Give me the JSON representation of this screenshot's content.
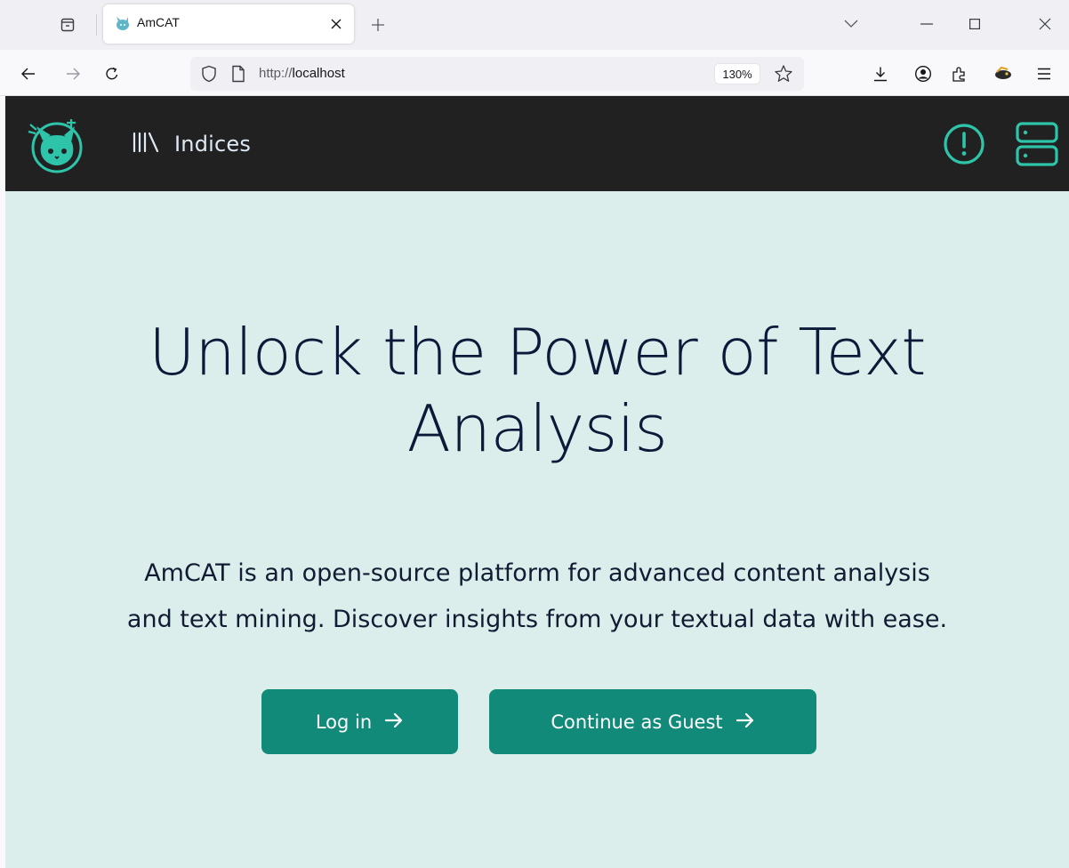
{
  "browser": {
    "tab": {
      "title": "AmCAT",
      "favicon": "amcat-cat-favicon"
    },
    "url": {
      "prefix": "http://",
      "host": "localhost"
    },
    "zoom": "130%",
    "icons": [
      "tab-list-icon",
      "close-icon",
      "plus-icon",
      "chevron-down-icon",
      "minimize-icon",
      "maximize-icon",
      "window-close-icon",
      "back-arrow-icon",
      "forward-arrow-icon",
      "reload-icon",
      "shield-icon",
      "page-icon",
      "star-icon",
      "download-icon",
      "account-icon",
      "extensions-icon",
      "extension-icon",
      "menu-icon"
    ]
  },
  "header": {
    "logo": "amcat-cat-logo",
    "nav": {
      "indices_label": "Indices",
      "indices_icon": "library-icon"
    },
    "right_icons": [
      "alert-circle-icon",
      "server-icon"
    ]
  },
  "hero": {
    "title_line1": "Unlock the Power of Text",
    "title_line2": "Analysis",
    "desc_line1": "AmCAT is an open-source platform for advanced content analysis",
    "desc_line2": "and text mining. Discover insights from your textual data with ease.",
    "login_label": "Log in",
    "guest_label": "Continue as Guest",
    "arrow": "→"
  },
  "colors": {
    "header_bg": "#212121",
    "hero_bg": "#dbeeeb",
    "accent": "#2ec4a9",
    "button_bg": "#128a7a",
    "title_text": "#0c1a3a"
  }
}
